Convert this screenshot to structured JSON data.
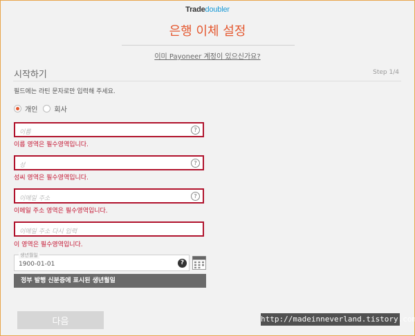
{
  "brand": {
    "logo_main": "Trade",
    "logo_accent": "doubler"
  },
  "header": {
    "title": "은행 이체 설정",
    "existing_account_link": "이미 Payoneer 계정이 있으신가요?"
  },
  "step": {
    "title": "시작하기",
    "indicator": "Step 1/4",
    "instruction": "필드에는 라틴 문자로만 입력해 주세요."
  },
  "account_type": {
    "options": [
      {
        "label": "개인",
        "selected": true
      },
      {
        "label": "회사",
        "selected": false
      }
    ]
  },
  "fields": {
    "first_name": {
      "placeholder": "이름",
      "value": "",
      "error": "이름 영역은 필수영역입니다."
    },
    "last_name": {
      "placeholder": "성",
      "value": "",
      "error": "성씨 영역은 필수영역입니다."
    },
    "email": {
      "placeholder": "이메일 주소",
      "value": "",
      "error": "이메일 주소 영역은 필수영역입니다."
    },
    "email_confirm": {
      "placeholder": "이메일 주소 다시 입력",
      "value": "",
      "error": "이 영역은 필수영역입니다."
    },
    "dob": {
      "label": "생년월일",
      "value": "1900-01-01",
      "hint": "정부 발행 신분증에 표시된 생년월일"
    }
  },
  "help_glyph": "?",
  "actions": {
    "next_label": "다음"
  },
  "watermark": "http://madeinneverland.tistory.com",
  "colors": {
    "accent": "#e4572e",
    "error": "#c4122f",
    "brand_blue": "#1a9ad6"
  }
}
